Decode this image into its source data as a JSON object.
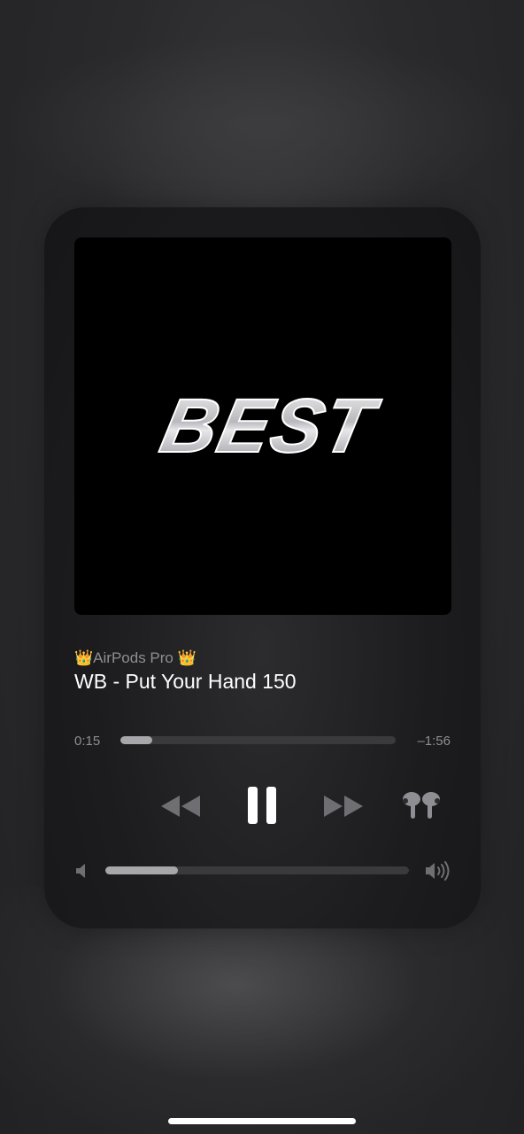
{
  "now_playing": {
    "artwork_text": "BEST",
    "device_name": "👑AirPods Pro 👑",
    "title": "WB - Put Your Hand 150",
    "elapsed": "0:15",
    "remaining": "–1:56",
    "progress_fraction": 0.115,
    "volume_fraction": 0.24
  },
  "controls": {
    "rewind_icon": "rewind-icon",
    "pause_icon": "pause-icon",
    "fast_forward_icon": "fast-forward-icon",
    "output_icon": "airpods-pro-icon",
    "volume_low_icon": "speaker-low-icon",
    "volume_high_icon": "speaker-high-icon"
  },
  "colors": {
    "primary_text": "#ffffff",
    "secondary_text": "#8e8e93",
    "track": "#3a3a3c",
    "fill": "#a7a7ab"
  }
}
